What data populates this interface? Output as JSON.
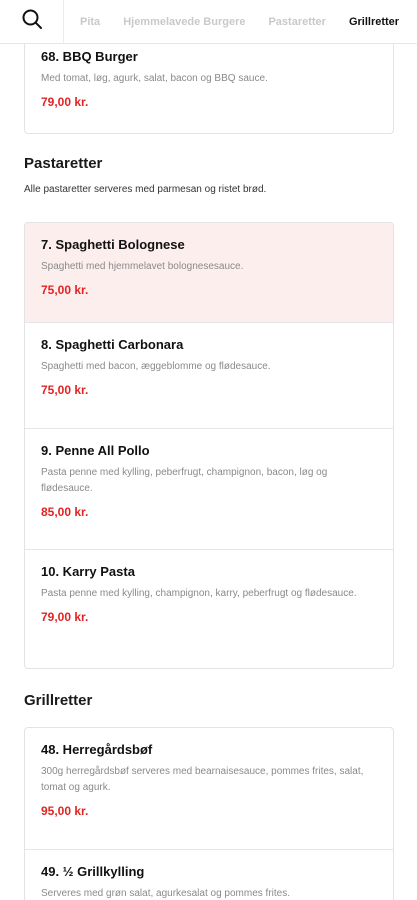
{
  "header": {
    "search_icon": "search-icon",
    "tabs": [
      {
        "label": "Pita",
        "active": false
      },
      {
        "label": "Hjemmelavede Burgere",
        "active": false
      },
      {
        "label": "Pastaretter",
        "active": false
      },
      {
        "label": "Grillretter",
        "active": true
      }
    ]
  },
  "burger_item": {
    "name": "68. BBQ Burger",
    "desc": "Med tomat, løg, agurk, salat, bacon og BBQ sauce.",
    "price": "79,00 kr."
  },
  "pasta": {
    "title": "Pastaretter",
    "subtitle": "Alle pastaretter serveres med parmesan og ristet brød.",
    "items": [
      {
        "name": "7. Spaghetti Bolognese",
        "desc": "Spaghetti med hjemmelavet bolognesesauce.",
        "price": "75,00 kr."
      },
      {
        "name": "8. Spaghetti Carbonara",
        "desc": "Spaghetti med bacon, æggeblomme og flødesauce.",
        "price": "75,00 kr."
      },
      {
        "name": "9. Penne All Pollo",
        "desc": "Pasta penne med kylling, peberfrugt, champignon, bacon, løg og flødesauce.",
        "price": "85,00 kr."
      },
      {
        "name": "10. Karry Pasta",
        "desc": "Pasta penne med kylling, champignon, karry, peberfrugt og flødesauce.",
        "price": "79,00 kr."
      }
    ]
  },
  "grill": {
    "title": "Grillretter",
    "items": [
      {
        "name": "48. Herregårdsbøf",
        "desc": "300g herregårdsbøf serveres med bearnaisesauce, pommes frites, salat, tomat og agurk.",
        "price": "95,00 kr."
      },
      {
        "name": "49. ½ Grillkylling",
        "desc": "Serveres med grøn salat, agurkesalat og pommes frites.",
        "price": ""
      }
    ]
  },
  "colors": {
    "price": "#e02424",
    "highlight_bg": "#fdeeee",
    "active_tab": "#111111",
    "inactive_tab": "#c9c9c9"
  }
}
